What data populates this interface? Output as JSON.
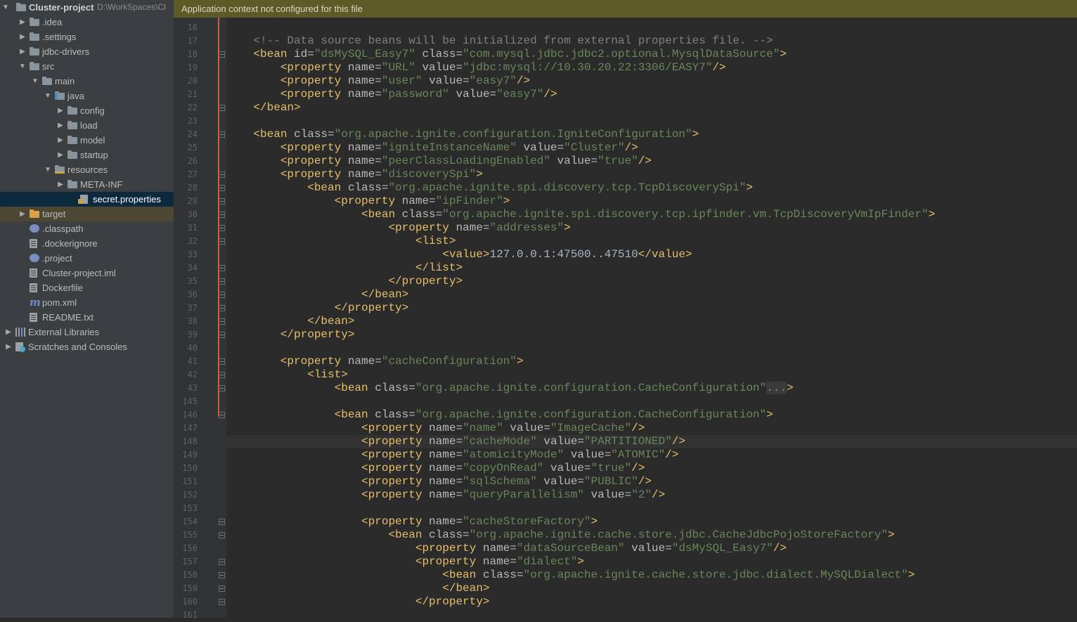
{
  "project_tree": {
    "root": {
      "name": "Cluster-project",
      "path": "D:\\WorkSpaces\\Cl"
    },
    "items": [
      {
        "label": ".idea",
        "icon": "folder-icon"
      },
      {
        "label": ".settings",
        "icon": "folder-icon"
      },
      {
        "label": "jdbc-drivers",
        "icon": "folder-icon"
      },
      {
        "label": "src",
        "icon": "folder-icon"
      },
      {
        "label": "main",
        "icon": "folder-icon"
      },
      {
        "label": "java",
        "icon": "source-folder-icon"
      },
      {
        "label": "config",
        "icon": "package-icon"
      },
      {
        "label": "load",
        "icon": "package-icon"
      },
      {
        "label": "model",
        "icon": "package-icon"
      },
      {
        "label": "startup",
        "icon": "package-icon"
      },
      {
        "label": "resources",
        "icon": "resources-folder-icon"
      },
      {
        "label": "META-INF",
        "icon": "package-icon"
      },
      {
        "label": "secret.properties",
        "icon": "properties-file-icon"
      },
      {
        "label": "target",
        "icon": "excluded-folder-icon"
      },
      {
        "label": ".classpath",
        "icon": "classpath-file-icon"
      },
      {
        "label": ".dockerignore",
        "icon": "text-file-icon"
      },
      {
        "label": ".project",
        "icon": "project-file-icon"
      },
      {
        "label": "Cluster-project.iml",
        "icon": "iml-file-icon"
      },
      {
        "label": "Dockerfile",
        "icon": "text-file-icon"
      },
      {
        "label": "pom.xml",
        "icon": "maven-icon"
      },
      {
        "label": "README.txt",
        "icon": "text-file-icon"
      },
      {
        "label": "External Libraries",
        "icon": "libraries-icon"
      },
      {
        "label": "Scratches and Consoles",
        "icon": "scratches-icon"
      }
    ]
  },
  "editor": {
    "banner": "Application context not configured for this file",
    "fold_placeholder": "...",
    "lines": [
      {
        "n": "16",
        "parts": []
      },
      {
        "n": "17",
        "parts": [
          [
            "com",
            "    <!-- Data source beans will be initialized from external properties file. -->"
          ]
        ]
      },
      {
        "n": "18",
        "parts": [
          [
            "tag",
            "    <bean "
          ],
          [
            "attr",
            "id="
          ],
          [
            "val",
            "\"dsMySQL_Easy7\" "
          ],
          [
            "attr",
            "class="
          ],
          [
            "val",
            "\"com.mysql.jdbc.jdbc2.optional.MysqlDataSource\""
          ],
          [
            "tag",
            ">"
          ]
        ]
      },
      {
        "n": "19",
        "parts": [
          [
            "tag",
            "        <property "
          ],
          [
            "attr",
            "name="
          ],
          [
            "val",
            "\"URL\" "
          ],
          [
            "attr",
            "value="
          ],
          [
            "val",
            "\"jdbc:mysql://10.30.20.22:3306/EASY7\""
          ],
          [
            "tag",
            "/>"
          ]
        ]
      },
      {
        "n": "20",
        "parts": [
          [
            "tag",
            "        <property "
          ],
          [
            "attr",
            "name="
          ],
          [
            "val",
            "\"user\" "
          ],
          [
            "attr",
            "value="
          ],
          [
            "val",
            "\"easy7\""
          ],
          [
            "tag",
            "/>"
          ]
        ]
      },
      {
        "n": "21",
        "parts": [
          [
            "tag",
            "        <property "
          ],
          [
            "attr",
            "name="
          ],
          [
            "val",
            "\"password\" "
          ],
          [
            "attr",
            "value="
          ],
          [
            "val",
            "\"easy7\""
          ],
          [
            "tag",
            "/>"
          ]
        ]
      },
      {
        "n": "22",
        "parts": [
          [
            "tag",
            "    </bean>"
          ]
        ]
      },
      {
        "n": "23",
        "parts": []
      },
      {
        "n": "24",
        "parts": [
          [
            "tag",
            "    <bean "
          ],
          [
            "attr",
            "class="
          ],
          [
            "val",
            "\"org.apache.ignite.configuration.IgniteConfiguration\""
          ],
          [
            "tag",
            ">"
          ]
        ]
      },
      {
        "n": "25",
        "parts": [
          [
            "tag",
            "        <property "
          ],
          [
            "attr",
            "name="
          ],
          [
            "val",
            "\"igniteInstanceName\" "
          ],
          [
            "attr",
            "value="
          ],
          [
            "val",
            "\"Cluster\""
          ],
          [
            "tag",
            "/>"
          ]
        ]
      },
      {
        "n": "26",
        "parts": [
          [
            "tag",
            "        <property "
          ],
          [
            "attr",
            "name="
          ],
          [
            "val",
            "\"peerClassLoadingEnabled\" "
          ],
          [
            "attr",
            "value="
          ],
          [
            "val",
            "\"true\""
          ],
          [
            "tag",
            "/>"
          ]
        ]
      },
      {
        "n": "27",
        "parts": [
          [
            "tag",
            "        <property "
          ],
          [
            "attr",
            "name="
          ],
          [
            "val",
            "\"discoverySpi\""
          ],
          [
            "tag",
            ">"
          ]
        ]
      },
      {
        "n": "28",
        "parts": [
          [
            "tag",
            "            <bean "
          ],
          [
            "attr",
            "class="
          ],
          [
            "val",
            "\"org.apache.ignite.spi.discovery.tcp.TcpDiscoverySpi\""
          ],
          [
            "tag",
            ">"
          ]
        ]
      },
      {
        "n": "29",
        "parts": [
          [
            "tag",
            "                <property "
          ],
          [
            "attr",
            "name="
          ],
          [
            "val",
            "\"ipFinder\""
          ],
          [
            "tag",
            ">"
          ]
        ]
      },
      {
        "n": "30",
        "parts": [
          [
            "tag",
            "                    <bean "
          ],
          [
            "attr",
            "class="
          ],
          [
            "val",
            "\"org.apache.ignite.spi.discovery.tcp.ipfinder.vm.TcpDiscoveryVmIpFinder\""
          ],
          [
            "tag",
            ">"
          ]
        ]
      },
      {
        "n": "31",
        "parts": [
          [
            "tag",
            "                        <property "
          ],
          [
            "attr",
            "name="
          ],
          [
            "val",
            "\"addresses\""
          ],
          [
            "tag",
            ">"
          ]
        ]
      },
      {
        "n": "32",
        "parts": [
          [
            "tag",
            "                            <list>"
          ]
        ]
      },
      {
        "n": "33",
        "parts": [
          [
            "tag",
            "                                <value>"
          ],
          [
            "text",
            "127.0.0.1:47500..47510"
          ],
          [
            "tag",
            "</value>"
          ]
        ]
      },
      {
        "n": "34",
        "parts": [
          [
            "tag",
            "                            </list>"
          ]
        ]
      },
      {
        "n": "35",
        "parts": [
          [
            "tag",
            "                        </property>"
          ]
        ]
      },
      {
        "n": "36",
        "parts": [
          [
            "tag",
            "                    </bean>"
          ]
        ]
      },
      {
        "n": "37",
        "parts": [
          [
            "tag",
            "                </property>"
          ]
        ]
      },
      {
        "n": "38",
        "parts": [
          [
            "tag",
            "            </bean>"
          ]
        ]
      },
      {
        "n": "39",
        "parts": [
          [
            "tag",
            "        </property>"
          ]
        ]
      },
      {
        "n": "40",
        "parts": []
      },
      {
        "n": "41",
        "parts": [
          [
            "tag",
            "        <property "
          ],
          [
            "attr",
            "name="
          ],
          [
            "val",
            "\"cacheConfiguration\""
          ],
          [
            "tag",
            ">"
          ]
        ]
      },
      {
        "n": "42",
        "parts": [
          [
            "tag",
            "            <list>"
          ]
        ]
      },
      {
        "n": "43",
        "parts": [
          [
            "tag",
            "                <bean "
          ],
          [
            "attr",
            "class="
          ],
          [
            "val",
            "\"org.apache.ignite.configuration.CacheConfiguration\""
          ],
          [
            "fold",
            "..."
          ],
          [
            "tag",
            ">"
          ]
        ]
      },
      {
        "n": "145",
        "parts": []
      },
      {
        "n": "146",
        "parts": [
          [
            "tag",
            "                <bean "
          ],
          [
            "attr",
            "class="
          ],
          [
            "val",
            "\"org.apache.ignite.configuration.CacheConfiguration\""
          ],
          [
            "tag",
            ">"
          ]
        ]
      },
      {
        "n": "147",
        "parts": [
          [
            "tag",
            "                    <property "
          ],
          [
            "attr",
            "name="
          ],
          [
            "val",
            "\"name\" "
          ],
          [
            "attr",
            "value="
          ],
          [
            "val",
            "\"ImageCache\""
          ],
          [
            "tag",
            "/>"
          ]
        ]
      },
      {
        "n": "148",
        "parts": [
          [
            "tag",
            "                    <property "
          ],
          [
            "attr",
            "name="
          ],
          [
            "val",
            "\"cacheMode\" "
          ],
          [
            "attr",
            "value="
          ],
          [
            "val",
            "\"PARTITIONED\""
          ],
          [
            "tag",
            "/>"
          ]
        ]
      },
      {
        "n": "149",
        "parts": [
          [
            "tag",
            "                    <property "
          ],
          [
            "attr",
            "name="
          ],
          [
            "val",
            "\"atomicityMode\" "
          ],
          [
            "attr",
            "value="
          ],
          [
            "val",
            "\"ATOMIC\""
          ],
          [
            "tag",
            "/>"
          ]
        ]
      },
      {
        "n": "150",
        "parts": [
          [
            "tag",
            "                    <property "
          ],
          [
            "attr",
            "name="
          ],
          [
            "val",
            "\"copyOnRead\" "
          ],
          [
            "attr",
            "value="
          ],
          [
            "val",
            "\"true\""
          ],
          [
            "tag",
            "/>"
          ]
        ]
      },
      {
        "n": "151",
        "parts": [
          [
            "tag",
            "                    <property "
          ],
          [
            "attr",
            "name="
          ],
          [
            "val",
            "\"sqlSchema\" "
          ],
          [
            "attr",
            "value="
          ],
          [
            "val",
            "\"PUBLIC\""
          ],
          [
            "tag",
            "/>"
          ]
        ]
      },
      {
        "n": "152",
        "parts": [
          [
            "tag",
            "                    <property "
          ],
          [
            "attr",
            "name="
          ],
          [
            "val",
            "\"queryParallelism\" "
          ],
          [
            "attr",
            "value="
          ],
          [
            "val",
            "\"2\""
          ],
          [
            "tag",
            "/>"
          ]
        ]
      },
      {
        "n": "153",
        "parts": []
      },
      {
        "n": "154",
        "parts": [
          [
            "tag",
            "                    <property "
          ],
          [
            "attr",
            "name="
          ],
          [
            "val",
            "\"cacheStoreFactory\""
          ],
          [
            "tag",
            ">"
          ]
        ]
      },
      {
        "n": "155",
        "parts": [
          [
            "tag",
            "                        <bean "
          ],
          [
            "attr",
            "class="
          ],
          [
            "val",
            "\"org.apache.ignite.cache.store.jdbc.CacheJdbcPojoStoreFactory\""
          ],
          [
            "tag",
            ">"
          ]
        ]
      },
      {
        "n": "156",
        "parts": [
          [
            "tag",
            "                            <property "
          ],
          [
            "attr",
            "name="
          ],
          [
            "val",
            "\"dataSourceBean\" "
          ],
          [
            "attr",
            "value="
          ],
          [
            "val",
            "\"dsMySQL_Easy7\""
          ],
          [
            "tag",
            "/>"
          ]
        ]
      },
      {
        "n": "157",
        "parts": [
          [
            "tag",
            "                            <property "
          ],
          [
            "attr",
            "name="
          ],
          [
            "val",
            "\"dialect\""
          ],
          [
            "tag",
            ">"
          ]
        ]
      },
      {
        "n": "158",
        "parts": [
          [
            "tag",
            "                                <bean "
          ],
          [
            "attr",
            "class="
          ],
          [
            "val",
            "\"org.apache.ignite.cache.store.jdbc.dialect.MySQLDialect\""
          ],
          [
            "tag",
            ">"
          ]
        ]
      },
      {
        "n": "159",
        "parts": [
          [
            "tag",
            "                                </bean>"
          ]
        ]
      },
      {
        "n": "160",
        "parts": [
          [
            "tag",
            "                            </property>"
          ]
        ]
      },
      {
        "n": "161",
        "parts": []
      }
    ]
  }
}
